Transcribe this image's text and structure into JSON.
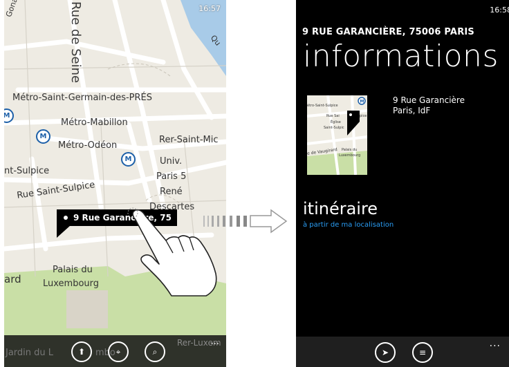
{
  "left_screen": {
    "status_time": "16:57",
    "map_labels": {
      "rue_de_seine": "Rue de Seine",
      "gonapa": "Gonapa",
      "quai": "Qu",
      "metro_saint_germain": "Métro-Saint-Germain-des-PRÉS",
      "metro_mabillon": "Métro-Mabillon",
      "metro_odeon": "Métro-Odéon",
      "rer_saint_mic": "Rer-Saint-Mic",
      "univ": "Univ.",
      "paris5": "Paris 5",
      "rene": "René",
      "descartes": "Descartes",
      "nt_sulpice": "nt-Sulpice",
      "rue_saint_sulpice": "Rue Saint-Sulpice",
      "palais_du": "Palais du",
      "luxembourg": "Luxembourg",
      "ard": "ard",
      "jardin_du": "Jardin du L",
      "jardin_tail": "mbo",
      "rer_lux": "Rer-Luxem"
    },
    "metro_icon": "M",
    "pin_label": "9 Rue Garancière, 75",
    "appbar": {
      "directions_icon": "directions-icon",
      "location_icon": "locate-me-icon",
      "search_icon": "search-icon",
      "more": "..."
    }
  },
  "right_screen": {
    "status_time": "16:58",
    "address_header": "9 RUE GARANCIÈRE, 75006 PARIS",
    "pivot_current": "informations",
    "pivot_next": "à",
    "address_line1": "9 Rue Garancière",
    "address_line2": "Paris, IdF",
    "thumbnail_labels": {
      "saint_sulpice": "étro-Saint-Sulpice",
      "rue_sai": "Rue Sai",
      "pice": "pice",
      "eglise": "Église",
      "saint_sulp": "Saint-Sulpic",
      "vaugirard": "e de Vaugirard",
      "palais_du": "Palais du",
      "luxembourg": "Luxembourg"
    },
    "route_title": "itinéraire",
    "route_subtitle": "à partir de ma localisation",
    "appbar": {
      "pin_icon": "pin-to-start-icon",
      "directions_icon": "directions-list-icon",
      "more": "..."
    }
  },
  "colors": {
    "accent": "#2a9df4",
    "metro_blue": "#1c5fa8",
    "park_green": "#c8dfa5",
    "map_bg": "#f0ede5"
  }
}
